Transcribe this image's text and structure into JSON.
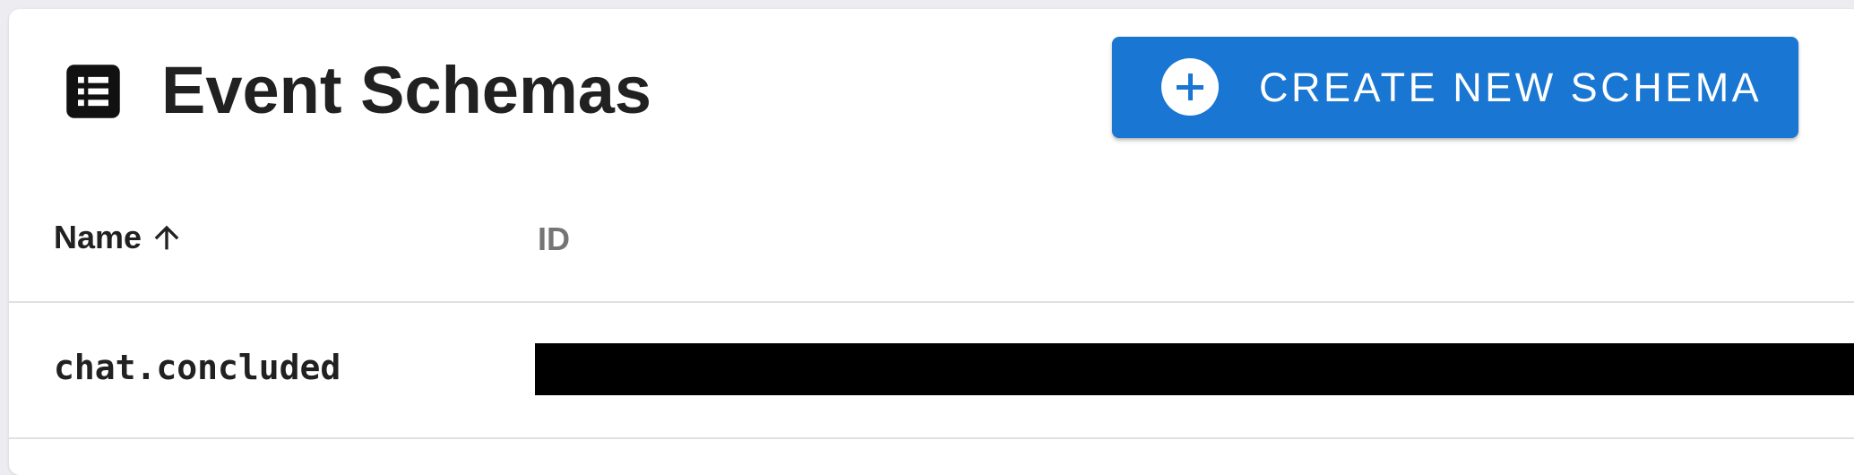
{
  "header": {
    "title": "Event Schemas",
    "title_icon": "table-list-icon",
    "create_button_label": "CREATE NEW SCHEMA",
    "create_button_icon": "plus-circle-icon"
  },
  "table": {
    "columns": [
      {
        "label": "Name",
        "sort": "ascending",
        "sort_icon": "arrow-up-icon"
      },
      {
        "label": "ID"
      }
    ],
    "rows": [
      {
        "name": "chat.concluded",
        "id": "[redacted]"
      }
    ]
  },
  "colors": {
    "accent": "#1976d2",
    "background": "#ececf1",
    "card": "#ffffff",
    "text": "#212121",
    "muted_header": "#757575"
  }
}
